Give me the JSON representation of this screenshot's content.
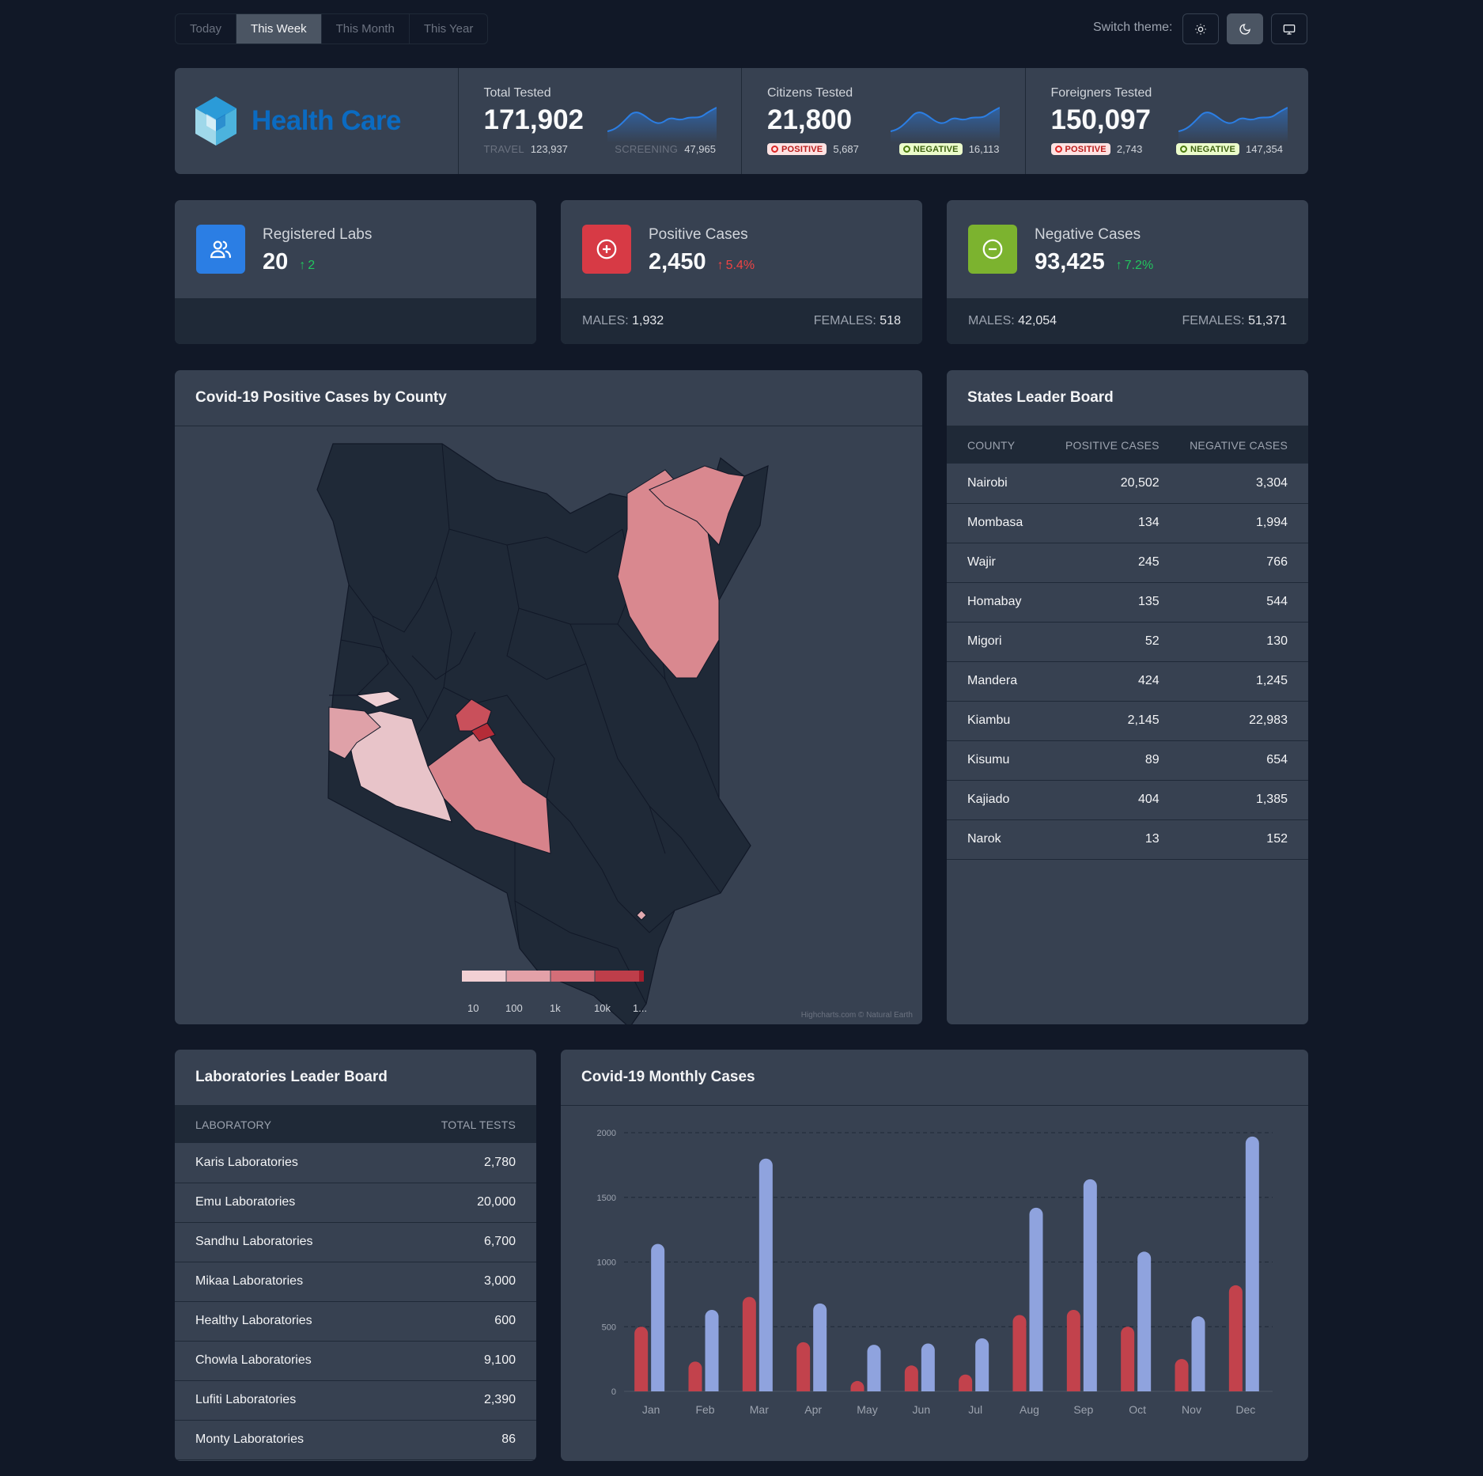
{
  "range_tabs": [
    "Today",
    "This Week",
    "This Month",
    "This Year"
  ],
  "active_tab": "This Week",
  "theme": {
    "label": "Switch theme:"
  },
  "brand": {
    "name": "Health Care",
    "color": "#0b6bc1"
  },
  "stats": {
    "total": {
      "label": "Total Tested",
      "value": "171,902",
      "travel_label": "TRAVEL",
      "travel": "123,937",
      "screening_label": "SCREENING",
      "screening": "47,965"
    },
    "citizens": {
      "label": "Citizens Tested",
      "value": "21,800",
      "positive_label": "POSITIVE",
      "positive": "5,687",
      "negative_label": "NEGATIVE",
      "negative": "16,113"
    },
    "foreigners": {
      "label": "Foreigners Tested",
      "value": "150,097",
      "positive_label": "POSITIVE",
      "positive": "2,743",
      "negative_label": "NEGATIVE",
      "negative": "147,354"
    }
  },
  "kpis": {
    "labs": {
      "label": "Registered Labs",
      "value": "20",
      "delta": "2",
      "color": "#2b7ee4"
    },
    "positive": {
      "label": "Positive Cases",
      "value": "2,450",
      "delta": "5.4%",
      "color": "#d73a45",
      "males_label": "MALES:",
      "males": "1,932",
      "females_label": "FEMALES:",
      "females": "518"
    },
    "negative": {
      "label": "Negative Cases",
      "value": "93,425",
      "delta": "7.2%",
      "color": "#7cb32f",
      "males_label": "MALES:",
      "males": "42,054",
      "females_label": "FEMALES:",
      "females": "51,371"
    }
  },
  "map": {
    "title": "Covid-19 Positive Cases by County",
    "legend": [
      "10",
      "100",
      "1k",
      "10k",
      "1..."
    ],
    "credit": "Highcharts.com © Natural Earth"
  },
  "states_board": {
    "title": "States Leader Board",
    "columns": [
      "COUNTY",
      "POSITIVE CASES",
      "NEGATIVE CASES"
    ],
    "rows": [
      [
        "Nairobi",
        "20,502",
        "3,304"
      ],
      [
        "Mombasa",
        "134",
        "1,994"
      ],
      [
        "Wajir",
        "245",
        "766"
      ],
      [
        "Homabay",
        "135",
        "544"
      ],
      [
        "Migori",
        "52",
        "130"
      ],
      [
        "Mandera",
        "424",
        "1,245"
      ],
      [
        "Kiambu",
        "2,145",
        "22,983"
      ],
      [
        "Kisumu",
        "89",
        "654"
      ],
      [
        "Kajiado",
        "404",
        "1,385"
      ],
      [
        "Narok",
        "13",
        "152"
      ]
    ]
  },
  "labs_board": {
    "title": "Laboratories Leader Board",
    "columns": [
      "LABORATORY",
      "TOTAL TESTS"
    ],
    "rows": [
      [
        "Karis Laboratories",
        "2,780"
      ],
      [
        "Emu Laboratories",
        "20,000"
      ],
      [
        "Sandhu Laboratories",
        "6,700"
      ],
      [
        "Mikaa Laboratories",
        "3,000"
      ],
      [
        "Healthy Laboratories",
        "600"
      ],
      [
        "Chowla Laboratories",
        "9,100"
      ],
      [
        "Lufiti Laboratories",
        "2,390"
      ],
      [
        "Monty Laboratories",
        "86"
      ]
    ]
  },
  "monthly": {
    "title": "Covid-19 Monthly Cases"
  },
  "chart_data": {
    "type": "bar",
    "categories": [
      "Jan",
      "Feb",
      "Mar",
      "Apr",
      "May",
      "Jun",
      "Jul",
      "Aug",
      "Sep",
      "Oct",
      "Nov",
      "Dec"
    ],
    "series": [
      {
        "values": [
          500,
          230,
          730,
          380,
          80,
          200,
          130,
          590,
          630,
          500,
          250,
          820
        ],
        "color": "#c2424c"
      },
      {
        "values": [
          1140,
          630,
          1800,
          680,
          360,
          370,
          410,
          1420,
          1640,
          1080,
          580,
          1970
        ],
        "color": "#8fa3de"
      }
    ],
    "yticks": [
      0,
      500,
      1000,
      1500,
      2000
    ],
    "ylim": [
      0,
      2000
    ],
    "grid": true
  }
}
